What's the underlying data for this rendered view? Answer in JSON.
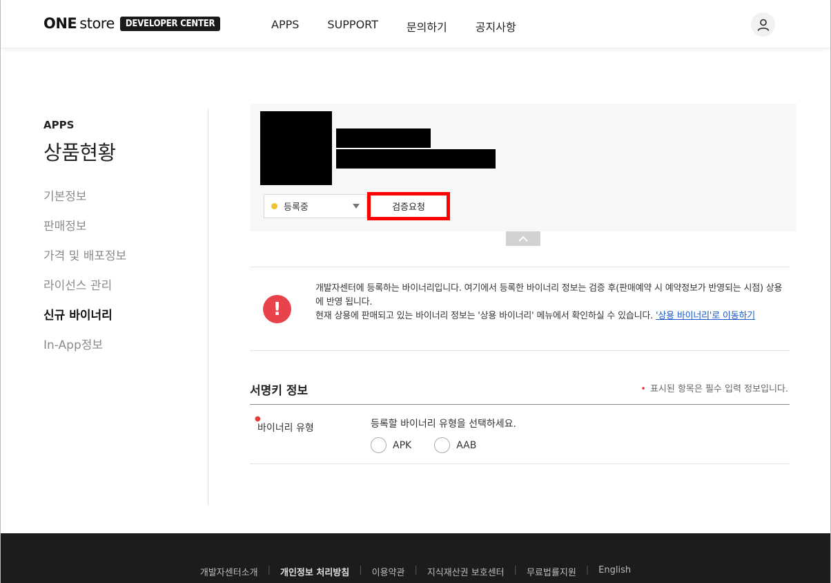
{
  "header": {
    "logo_one": "ONE",
    "logo_store": "store",
    "logo_badge": "DEVELOPER CENTER",
    "nav": [
      "APPS",
      "SUPPORT",
      "문의하기",
      "공지사항"
    ]
  },
  "sidebar": {
    "section": "APPS",
    "title": "상품현황",
    "items": [
      {
        "label": "기본정보"
      },
      {
        "label": "판매정보"
      },
      {
        "label": "가격 및 배포정보"
      },
      {
        "label": "라이선스 관리"
      },
      {
        "label": "신규 바이너리"
      },
      {
        "label": "In-App정보"
      }
    ]
  },
  "app_panel": {
    "status_label": "등록중",
    "status_color": "#f2c12e",
    "verify_button": "검증요청"
  },
  "notice": {
    "line1": "개발자센터에 등록하는 바이너리입니다. 여기에서 등록한 바이너리 정보는 검증 후(판매예약 시 예약정보가 반영되는 시점) 상용에 반영 됩니다.",
    "line2": "현재 상용에 판매되고 있는 바이너리 정보는 '상용 바이너리' 메뉴에서 확인하실 수 있습니다. ",
    "link": "'상용 바이너리'로 이동하기",
    "icon": "exclamation-icon"
  },
  "signing": {
    "title": "서명키 정보",
    "required_note": "표시된 항목은 필수 입력 정보입니다.",
    "binary_type_label": "바이너리 유형",
    "binary_type_help": "등록할 바이너리 유형을 선택하세요.",
    "options": [
      "APK",
      "AAB"
    ]
  },
  "footer": {
    "links": [
      "개발자센터소개",
      "개인정보 처리방침",
      "이용약관",
      "지식재산권 보호센터",
      "무료법률지원",
      "English"
    ]
  }
}
